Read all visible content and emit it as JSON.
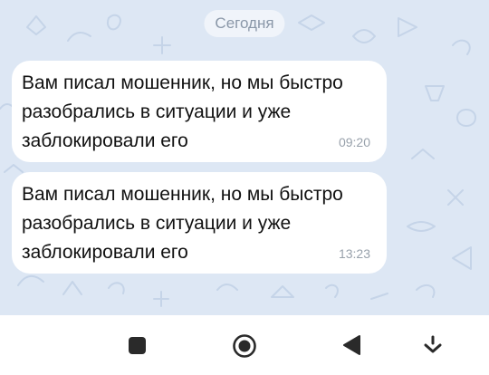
{
  "date_separator": "Сегодня",
  "messages": [
    {
      "text": "Вам писал мошенник, но мы быстро\nразобрались в ситуации и уже\nзаблокировали его",
      "time": "09:20"
    },
    {
      "text": "Вам писал мошенник, но мы быстро\nразобрались в ситуации и уже\nзаблокировали его",
      "time": "13:23"
    }
  ],
  "navigation_bar": {
    "buttons": [
      "recents-square-icon",
      "home-circle-icon",
      "back-triangle-icon",
      "keyboard-hide-icon"
    ]
  },
  "colors": {
    "chat_background": "#dde7f4",
    "bubble": "#ffffff",
    "timestamp": "#98a1ab",
    "date_pill_text": "#8a97a8"
  }
}
